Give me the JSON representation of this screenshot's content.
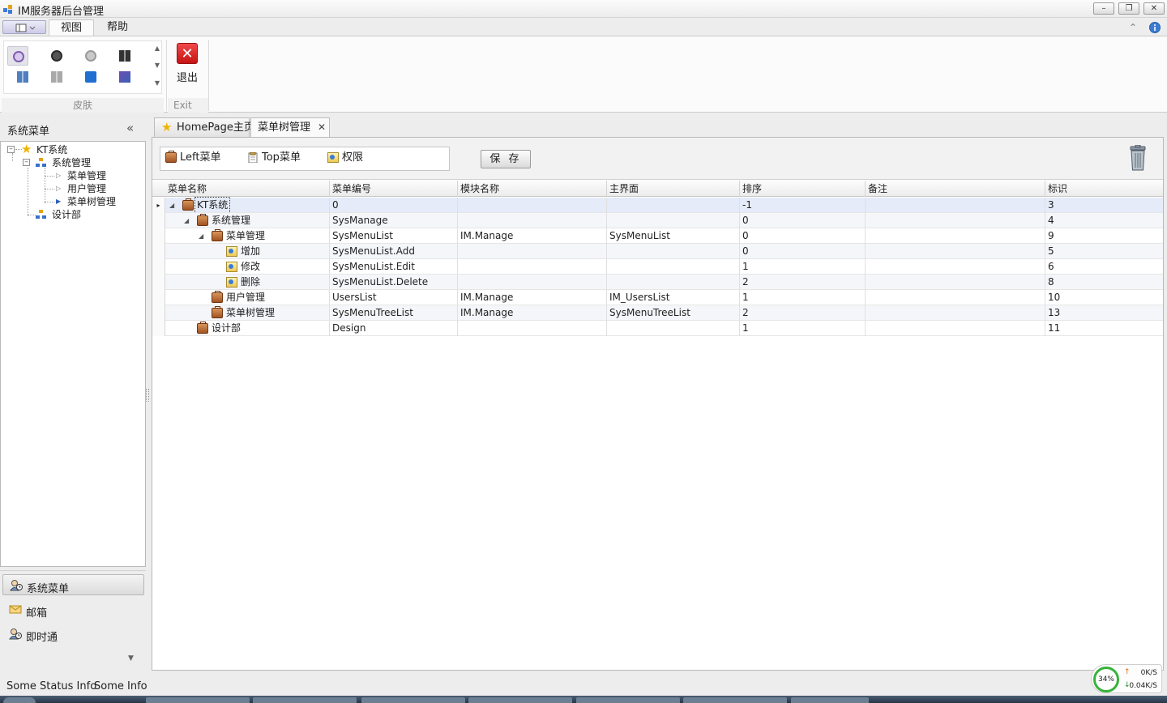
{
  "window": {
    "title": "IM服务器后台管理",
    "controls": {
      "minimize": "–",
      "restore": "❐",
      "close": "✕"
    }
  },
  "ribbon": {
    "tabs": [
      {
        "label": "视图",
        "active": true
      },
      {
        "label": "帮助",
        "active": false
      }
    ],
    "groups": {
      "skin_label": "皮肤",
      "exit_group_label": "Exit",
      "exit_button_label": "退出"
    }
  },
  "nav": {
    "title": "系统菜单",
    "collapse_glyph": "«",
    "tree": {
      "root": "KT系统",
      "system": "系统管理",
      "menu_mgmt": "菜单管理",
      "user_mgmt": "用户管理",
      "menutree_mgmt": "菜单树管理",
      "design": "设计部"
    },
    "bar_buttons": [
      {
        "label": "系统菜单",
        "active": true
      },
      {
        "label": "邮箱",
        "active": false
      },
      {
        "label": "即时通",
        "active": false
      }
    ]
  },
  "doc_tabs": [
    {
      "label": "HomePage主页",
      "active": false
    },
    {
      "label": "菜单树管理",
      "active": true
    }
  ],
  "toolbar": {
    "menu_types": [
      "Left菜单",
      "Top菜单",
      "权限"
    ],
    "save_label": "保 存"
  },
  "grid": {
    "columns": [
      "菜单名称",
      "菜单编号",
      "模块名称",
      "主界面",
      "排序",
      "备注",
      "标识"
    ],
    "rows": [
      {
        "name": "KT系统",
        "code": "0",
        "module": "",
        "form": "",
        "order": "-1",
        "note": "",
        "id": "3"
      },
      {
        "name": "系统管理",
        "code": "SysManage",
        "module": "",
        "form": "",
        "order": "0",
        "note": "",
        "id": "4"
      },
      {
        "name": "菜单管理",
        "code": "SysMenuList",
        "module": "IM.Manage",
        "form": "SysMenuList",
        "order": "0",
        "note": "",
        "id": "9"
      },
      {
        "name": "增加",
        "code": "SysMenuList.Add",
        "module": "",
        "form": "",
        "order": "0",
        "note": "",
        "id": "5"
      },
      {
        "name": "修改",
        "code": "SysMenuList.Edit",
        "module": "",
        "form": "",
        "order": "1",
        "note": "",
        "id": "6"
      },
      {
        "name": "删除",
        "code": "SysMenuList.Delete",
        "module": "",
        "form": "",
        "order": "2",
        "note": "",
        "id": "8"
      },
      {
        "name": "用户管理",
        "code": "UsersList",
        "module": "IM.Manage",
        "form": "IM_UsersList",
        "order": "1",
        "note": "",
        "id": "10"
      },
      {
        "name": "菜单树管理",
        "code": "SysMenuTreeList",
        "module": "IM.Manage",
        "form": "SysMenuTreeList",
        "order": "2",
        "note": "",
        "id": "13"
      },
      {
        "name": "设计部",
        "code": "Design",
        "module": "",
        "form": "",
        "order": "1",
        "note": "",
        "id": "11"
      }
    ]
  },
  "status": {
    "left": "Some Status Info",
    "right": "Some Info"
  },
  "netmon": {
    "percent": "34%",
    "upload": "0K/S",
    "download": "0.04K/S"
  },
  "icons": {
    "row_indicator": "▸",
    "expanded": "◢",
    "tree_expander": "⊟"
  }
}
